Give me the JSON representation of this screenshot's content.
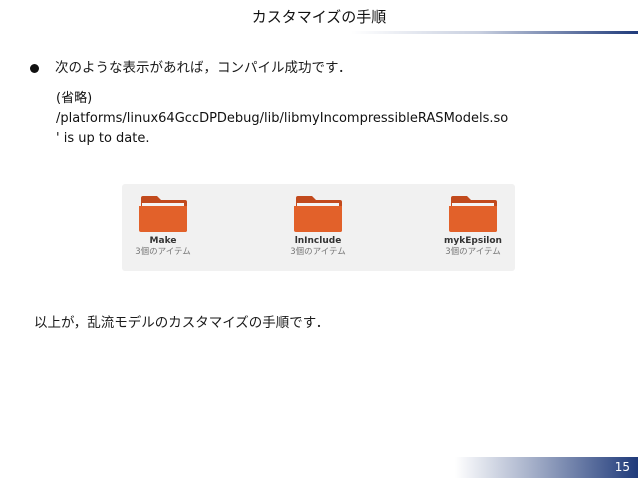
{
  "slide": {
    "title": "カスタマイズの手順",
    "bullet_text": "次のような表示があれば，コンパイル成功です．",
    "code_lines": [
      "(省略)",
      "/platforms/linux64GccDPDebug/lib/libmyIncompressibleRASModels.so",
      "' is up to date."
    ],
    "summary": "以上が，乱流モデルのカスタマイズの手順です．",
    "page_number": "15"
  },
  "file_browser": {
    "folders": [
      {
        "name": "Make",
        "count": "3個のアイテム"
      },
      {
        "name": "lnInclude",
        "count": "3個のアイテム"
      },
      {
        "name": "mykEpsilon",
        "count": "3個のアイテム"
      }
    ]
  },
  "colors": {
    "folder_orange": "#e2612a",
    "folder_back": "#c24a1d",
    "accent_navy": "#1f3a7a"
  },
  "icons": {
    "folder": "folder-icon",
    "bullet": "bullet-dot"
  }
}
